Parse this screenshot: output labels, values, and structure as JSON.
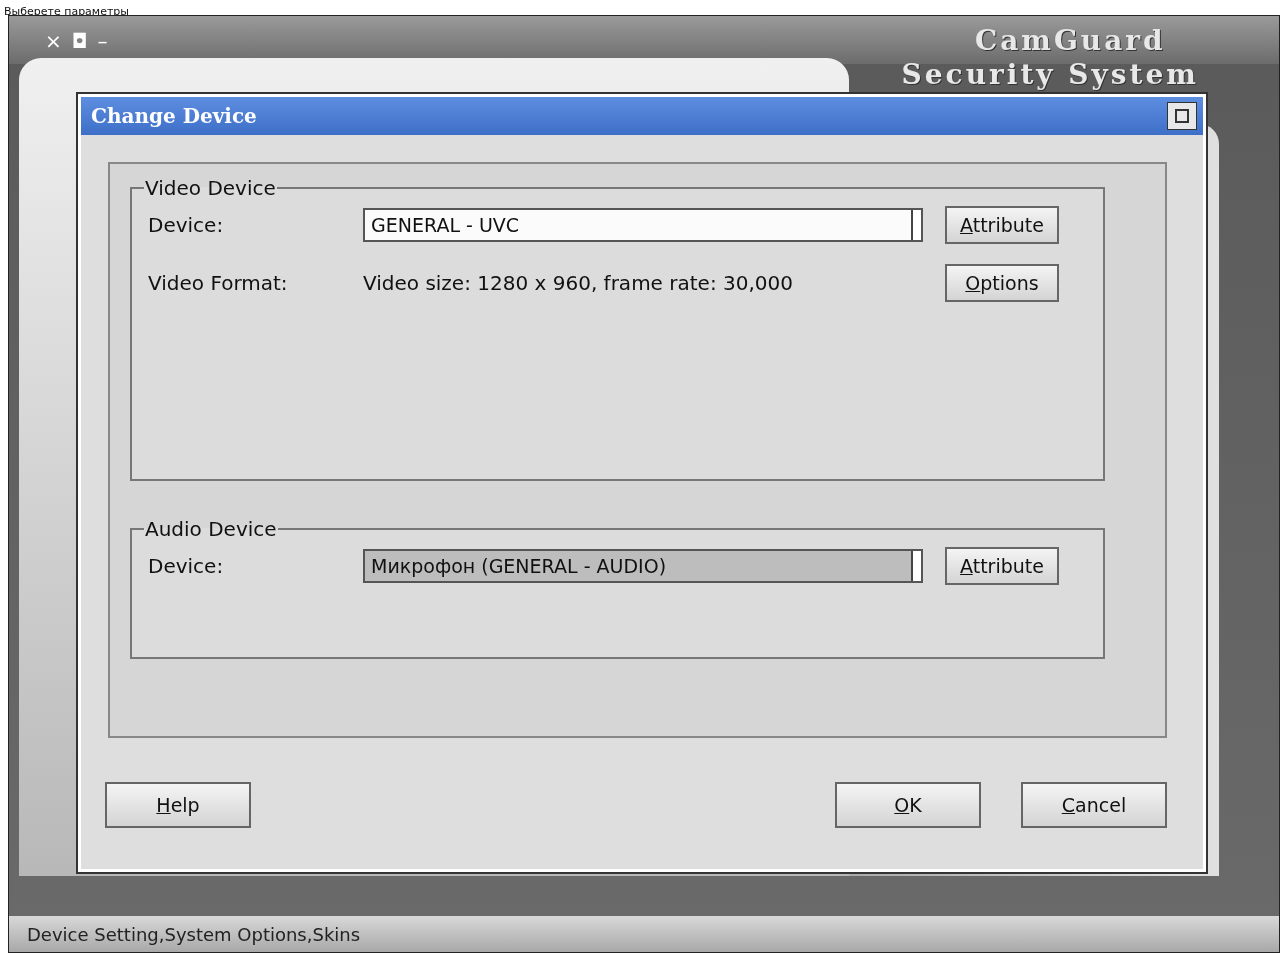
{
  "caption": "Выберете параметры",
  "app": {
    "window_controls": [
      "×",
      "◘",
      "–"
    ],
    "brand": "CamGuard",
    "brand_subtitle": "Security System",
    "status_bar": "Device Setting,System Options,Skins"
  },
  "dialog": {
    "title": "Change Device",
    "video": {
      "legend": "Video Device",
      "device_label": "Device:",
      "device_value": "GENERAL - UVC",
      "attribute_button": "Attribute",
      "format_label": "Video Format:",
      "format_value": "Video size: 1280 x 960, frame rate: 30,000",
      "options_button": "Options"
    },
    "audio": {
      "legend": "Audio Device",
      "device_label": "Device:",
      "device_value": "Микрофон (GENERAL - AUDIO)",
      "attribute_button": "Attribute"
    },
    "buttons": {
      "help": "Help",
      "ok": "OK",
      "cancel": "Cancel"
    }
  }
}
